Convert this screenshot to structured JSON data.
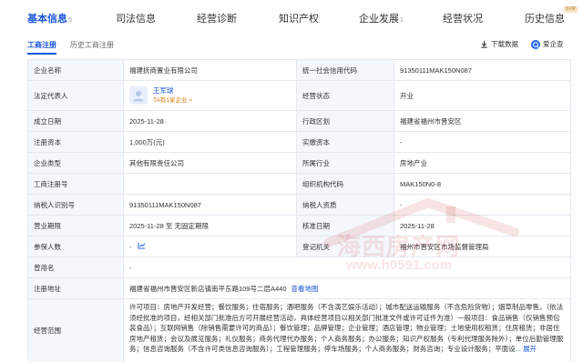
{
  "nav": {
    "tabs": [
      {
        "label": "基本信息",
        "count": "5"
      },
      {
        "label": "司法信息"
      },
      {
        "label": "经营诊断"
      },
      {
        "label": "知识产权"
      },
      {
        "label": "企业发展",
        "count": "1"
      },
      {
        "label": "经营状况"
      },
      {
        "label": "历史信息"
      }
    ],
    "svip": "SVIP"
  },
  "subtabs": {
    "current": "工商注册",
    "history": "历史工商注册"
  },
  "tools": {
    "download": "下载数据",
    "ai": "爱企查"
  },
  "registration": {
    "company_name_label": "企业名称",
    "company_name": "福建抚商置业有限公司",
    "credit_code_label": "统一社会信用代码",
    "credit_code": "91350111MAK150N087",
    "legal_rep_label": "法定代表人",
    "legal_rep_avatar": "王",
    "legal_rep": "王军球",
    "legal_rep_sub": "TA有1家企业 >",
    "status_label": "经营状态",
    "status": "开业",
    "founded_label": "成立日期",
    "founded": "2025-11-28",
    "district_label": "行政区划",
    "district": "福建省福州市晋安区",
    "reg_capital_label": "注册资本",
    "reg_capital": "1,000万(元)",
    "paid_capital_label": "实缴资本",
    "paid_capital": "-",
    "type_label": "企业类型",
    "type": "其他有限责任公司",
    "industry_label": "所属行业",
    "industry": "房地产业",
    "reg_no_label": "工商注册号",
    "reg_no": "",
    "org_code_label": "组织机构代码",
    "org_code": "MAK150N0-8",
    "taxpayer_id_label": "纳税人识别号",
    "taxpayer_id": "91350111MAK150N087",
    "taxpayer_qual_label": "纳税人资质",
    "taxpayer_qual": "-",
    "term_label": "营业期限",
    "term": "2025-11-28 至 无固定期限",
    "approval_label": "核准日期",
    "approval": "2025-11-28",
    "insured_label": "参保人数",
    "insured": "-",
    "authority_label": "登记机关",
    "authority": "福州市晋安区市场监督管理局",
    "former_label": "曾用名",
    "former": "-",
    "address_label": "注册地址",
    "address": "福建省福州市晋安区新店镇南平东路109号二层A440",
    "map_link": "查看地图",
    "scope_label": "经营范围",
    "scope_text": "许可项目：房地产开发经营；餐饮服务；住宿服务；酒吧服务（不含演艺娱乐活动）；城市配送运输服务（不含危险货物）；烟草制品零售。（依法须经批准的项目，经相关部门批准后方可开展经营活动，具体经营项目以相关部门批准文件或许可证件为准）一般项目：食品销售（仅销售预包装食品）；互联网销售（除销售需要许可的商品）；餐饮管理；品牌管理；企业管理；酒店管理；物业管理；土地使用权租赁；住房租赁；非居住房地产租赁；会议及展览服务；礼仪服务；商务代理代办服务；个人商务服务；办公服务；知识产权服务（专利代理服务除外）；单位后勤管理服务；信息咨询服务（不含许可类信息咨询服务）；工程管理服务；停车场服务；个人商务服务；财务咨询；专业设计服务；平面设",
    "expand": "... 展开"
  },
  "watermark": {
    "line1": "海西房产网",
    "line2": "www.h0591.com"
  }
}
